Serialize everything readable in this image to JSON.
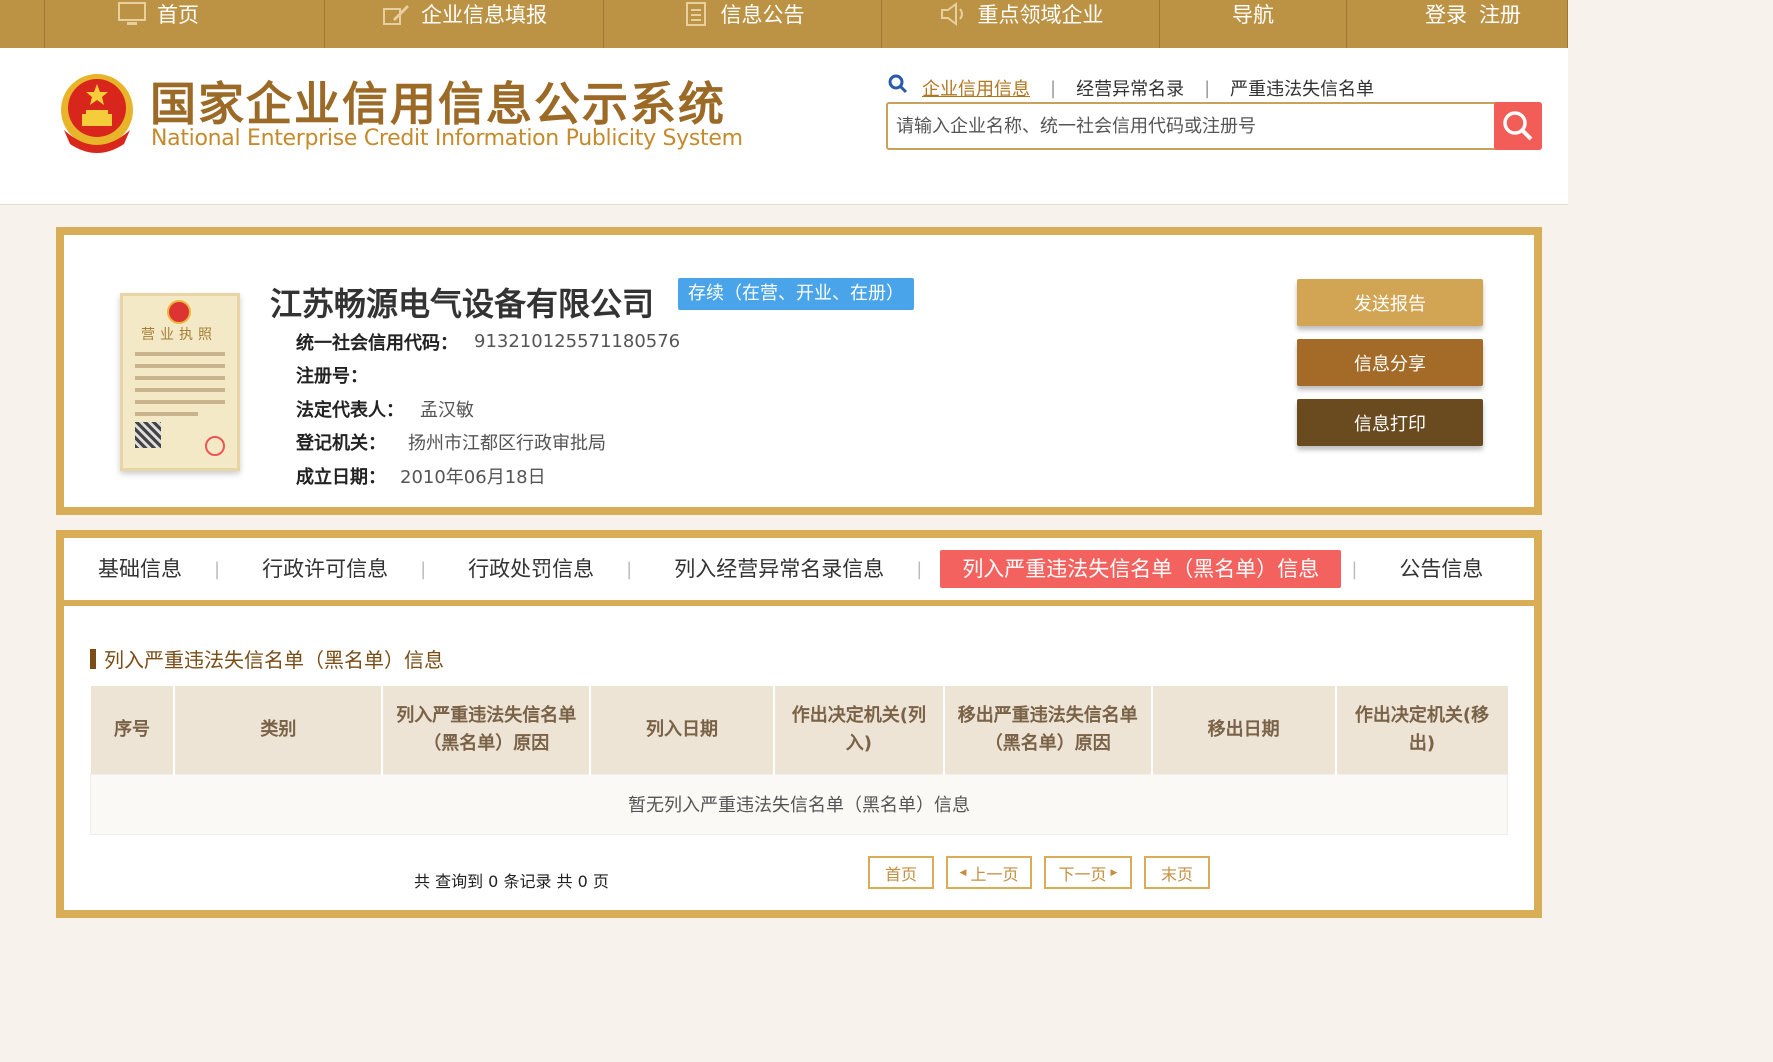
{
  "topnav": {
    "home": "首页",
    "fill": "企业信息填报",
    "notice": "信息公告",
    "key_field": "重点领域企业",
    "guide": "导航",
    "login": "登录",
    "register": "注册"
  },
  "header": {
    "logo_cn": "国家企业信用信息公示系统",
    "logo_en": "National Enterprise Credit Information Publicity System",
    "search_links": [
      "企业信用信息",
      "经营异常名录",
      "严重违法失信名单"
    ],
    "search_placeholder": "请输入企业名称、统一社会信用代码或注册号"
  },
  "company": {
    "license_title": "营业执照",
    "name": "江苏畅源电气设备有限公司",
    "status": "存续（在营、开业、在册）",
    "rows": [
      {
        "label": "统一社会信用代码：",
        "value": "913210125571180576"
      },
      {
        "label": "注册号：",
        "value": ""
      },
      {
        "label": "法定代表人：",
        "value": "孟汉敏"
      },
      {
        "label": "登记机关：",
        "value": "扬州市江都区行政审批局"
      },
      {
        "label": "成立日期：",
        "value": "2010年06月18日"
      }
    ],
    "actions": {
      "send": "发送报告",
      "share": "信息分享",
      "print": "信息打印"
    }
  },
  "tabs": [
    {
      "label": "基础信息",
      "active": false
    },
    {
      "label": "行政许可信息",
      "active": false
    },
    {
      "label": "行政处罚信息",
      "active": false
    },
    {
      "label": "列入经营异常名录信息",
      "active": false
    },
    {
      "label": "列入严重违法失信名单（黑名单）信息",
      "active": true
    },
    {
      "label": "公告信息",
      "active": false
    }
  ],
  "section": {
    "title": "列入严重违法失信名单（黑名单）信息",
    "columns": [
      "序号",
      "类别",
      "列入严重违法失信名单（黑名单）原因",
      "列入日期",
      "作出决定机关(列入)",
      "移出严重违法失信名单（黑名单）原因",
      "移出日期",
      "作出决定机关(移出)"
    ],
    "empty_text": "暂无列入严重违法失信名单（黑名单）信息"
  },
  "pager": {
    "summary": "共 查询到 0 条记录 共 0 页",
    "first": "首页",
    "prev": "上一页",
    "next": "下一页",
    "last": "末页"
  },
  "colors": {
    "nav_gold": "#bc9245",
    "panel_border": "#d9ad55",
    "active_tab": "#f3625e",
    "status_blue": "#4aa4ea",
    "btn_send": "#d1a553",
    "btn_share": "#a36b27",
    "btn_print": "#6a4a1f"
  }
}
